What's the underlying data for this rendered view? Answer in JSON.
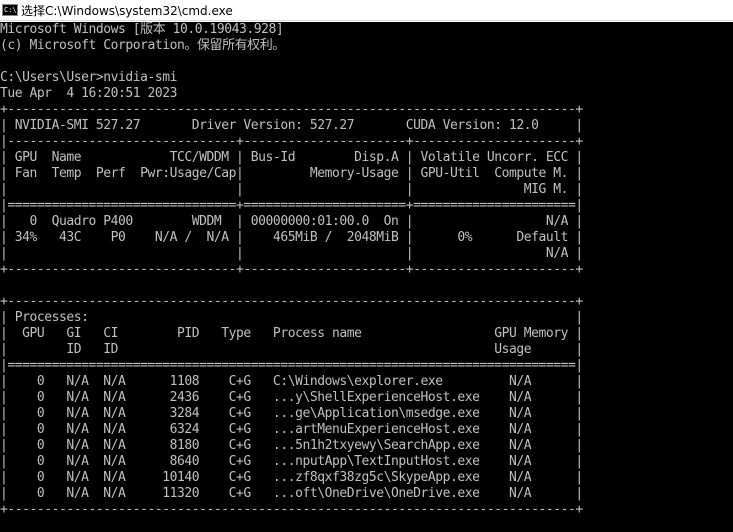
{
  "window": {
    "title": "选择C:\\Windows\\system32\\cmd.exe",
    "icon_label": "C:\\"
  },
  "console": {
    "lines": [
      "Microsoft Windows [版本 10.0.19043.928]",
      "(c) Microsoft Corporation。保留所有权利。",
      "",
      "C:\\Users\\User>nvidia-smi",
      "Tue Apr  4 16:20:51 2023",
      "+-----------------------------------------------------------------------------+",
      "| NVIDIA-SMI 527.27       Driver Version: 527.27       CUDA Version: 12.0     |",
      "|-------------------------------+----------------------+----------------------+",
      "| GPU  Name            TCC/WDDM | Bus-Id        Disp.A | Volatile Uncorr. ECC |",
      "| Fan  Temp  Perf  Pwr:Usage/Cap|         Memory-Usage | GPU-Util  Compute M. |",
      "|                               |                      |               MIG M. |",
      "|===============================+======================+======================|",
      "|   0  Quadro P400        WDDM  | 00000000:01:00.0  On |                  N/A |",
      "| 34%   43C    P0    N/A /  N/A |    465MiB /  2048MiB |      0%      Default |",
      "|                               |                      |                  N/A |",
      "+-------------------------------+----------------------+----------------------+",
      "",
      "+-----------------------------------------------------------------------------+",
      "| Processes:                                                                  |",
      "|  GPU   GI   CI        PID   Type   Process name                  GPU Memory |",
      "|        ID   ID                                                   Usage      |",
      "|=============================================================================|",
      "|    0   N/A  N/A      1108    C+G   C:\\Windows\\explorer.exe         N/A      |",
      "|    0   N/A  N/A      2436    C+G   ...y\\ShellExperienceHost.exe    N/A      |",
      "|    0   N/A  N/A      3284    C+G   ...ge\\Application\\msedge.exe    N/A      |",
      "|    0   N/A  N/A      6324    C+G   ...artMenuExperienceHost.exe    N/A      |",
      "|    0   N/A  N/A      8180    C+G   ...5n1h2txyewy\\SearchApp.exe    N/A      |",
      "|    0   N/A  N/A      8640    C+G   ...nputApp\\TextInputHost.exe    N/A      |",
      "|    0   N/A  N/A     10140    C+G   ...zf8qxf38zg5c\\SkypeApp.exe    N/A      |",
      "|    0   N/A  N/A     11320    C+G   ...oft\\OneDrive\\OneDrive.exe    N/A      |",
      "+-----------------------------------------------------------------------------+"
    ]
  }
}
